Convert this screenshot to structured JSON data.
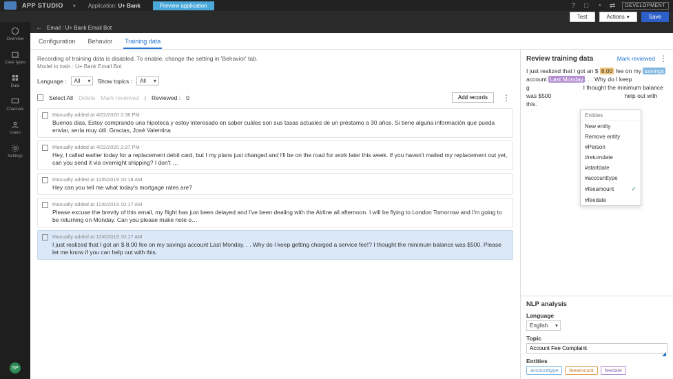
{
  "topbar": {
    "app_title": "APP STUDIO",
    "crumb_prefix": "Application:",
    "crumb_app": "U+ Bank",
    "preview": "Preview application",
    "env": "DEVELOPMENT"
  },
  "subbar": {
    "test": "Test",
    "actions": "Actions",
    "save": "Save"
  },
  "leftnav": {
    "items": [
      {
        "label": "Overview"
      },
      {
        "label": "Case types"
      },
      {
        "label": "Data"
      },
      {
        "label": "Channels"
      },
      {
        "label": "Users"
      },
      {
        "label": "Settings"
      }
    ],
    "user_initials": "SP"
  },
  "breadcrumb": {
    "text": "Email : U+ Bank Email Bot"
  },
  "tabs": {
    "items": [
      "Configuration",
      "Behavior",
      "Training data"
    ],
    "active": 2
  },
  "center": {
    "info": "Recording of training data is disabled. To enable, change the setting in 'Behavior' tab.",
    "model": "Model to train : U+ Bank Email Bot",
    "lang_label": "Language :",
    "lang_value": "All",
    "topics_label": "Show topics :",
    "topics_value": "All",
    "select_all": "Select All",
    "delete": "Delete",
    "mark_reviewed": "Mark reviewed",
    "reviewed_label": "Reviewed :",
    "reviewed_count": "0",
    "add_records": "Add records"
  },
  "records": [
    {
      "meta": "Manually added at 4/22/2020 2:38 PM",
      "text": "Buenos días, Estoy comprando una hipoteca y estoy interesado en saber cuáles son sus tasas actuales de un préstamo a 30 años. Si tiene alguna información que pueda enviar, sería muy útil. Gracias, José Valentina"
    },
    {
      "meta": "Manually added at 4/22/2020 2:37 PM",
      "text": "Hey, I called earlier today for a replacement debit card, but I my plans just changed and I'll be on the road for work later this week. If you haven't mailed my replacement out yet, can you send it via overnight shipping? I don't …"
    },
    {
      "meta": "Manually added at 12/6/2019 10:18 AM",
      "text": "Hey can you tell me what today's mortgage rates are?"
    },
    {
      "meta": "Manually added at 12/6/2019 10:17 AM",
      "text": "Please excuse the brevity of this email, my flight has just been delayed and I've been dealing with the Airline all afternoon. I will be flying to London Tomorrow and I'm going to be returning on Monday. Can you please make note o…"
    },
    {
      "meta": "Manually added at 12/6/2019 10:17 AM",
      "text": "I just realized that I got an $ 8.00 fee on my savings account Last Monday. . . Why do I keep getting charged a service fee!? I thought the minimum balance was $500. Please let me know if you can help out with this.",
      "selected": true
    }
  ],
  "review": {
    "title": "Review training data",
    "mark": "Mark reviewed",
    "t1": "I just realized that I got an $ ",
    "fee": "8.00",
    "t2": " fee on my ",
    "acct": "savings",
    "t3": " account ",
    "date": "Last Monday",
    "t4": ". . . Why do I keep g",
    "t5": "I thought the minimum balance was $500",
    "t6": "help out with this."
  },
  "context_menu": {
    "header": "Entities",
    "new_entity": "New entity",
    "remove_entity": "Remove entity",
    "items": [
      "#Person",
      "#returndate",
      "#startdate",
      "#accounttype",
      "#feeamount",
      "#feedate"
    ],
    "checked": 4
  },
  "nlp": {
    "title": "NLP analysis",
    "lang_label": "Language",
    "lang_value": "English",
    "topic_label": "Topic",
    "topic_value": "Account Fee Complaint",
    "entities_label": "Entities",
    "entities": [
      {
        "label": "accounttype",
        "cls": "ent-acct"
      },
      {
        "label": "feeamount",
        "cls": "ent-fee"
      },
      {
        "label": "feedate",
        "cls": "ent-date"
      }
    ]
  }
}
